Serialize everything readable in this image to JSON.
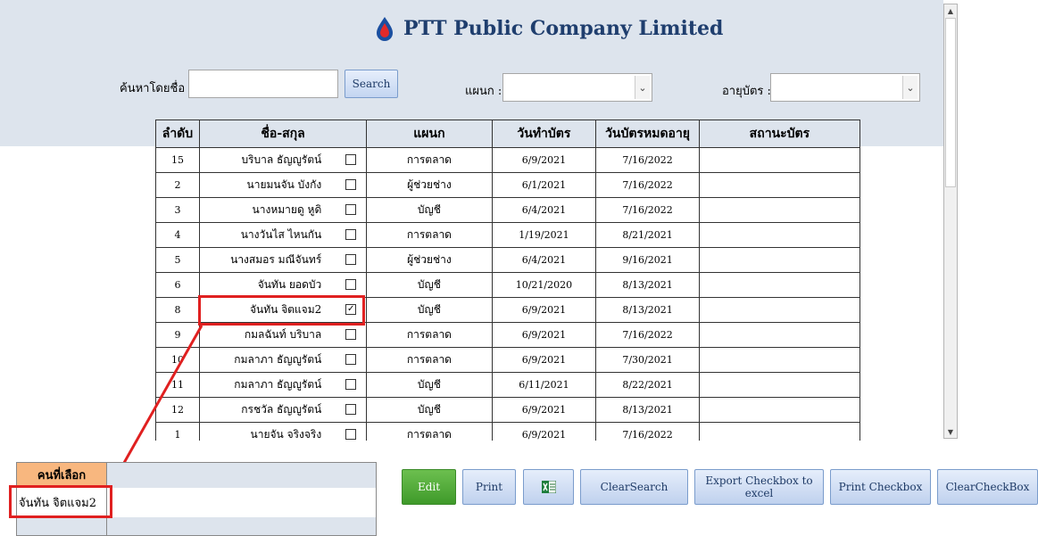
{
  "header": {
    "title": "PTT Public Company Limited"
  },
  "filters": {
    "search_label": "ค้นหาโดยชื่อ :",
    "search_value": "",
    "search_button": "Search",
    "dept_label": "แผนก :",
    "dept_value": "",
    "age_label": "อายุบัตร :",
    "age_value": ""
  },
  "table": {
    "columns": [
      "ลำดับ",
      "ชื่อ-สกุล",
      "แผนก",
      "วันทำบัตร",
      "วันบัตรหมดอายุ",
      "สถานะบัตร"
    ],
    "rows": [
      {
        "seq": "15",
        "name": "บริบาล ธัญญูรัตน์",
        "dept": "การตลาด",
        "issue": "6/9/2021",
        "expire": "7/16/2022",
        "status": "",
        "checked": false
      },
      {
        "seq": "2",
        "name": "นายมนจัน บังกัง",
        "dept": "ผู้ช่วยช่าง",
        "issue": "6/1/2021",
        "expire": "7/16/2022",
        "status": "",
        "checked": false
      },
      {
        "seq": "3",
        "name": "นางหมายดู หูดิ",
        "dept": "บัญชี",
        "issue": "6/4/2021",
        "expire": "7/16/2022",
        "status": "",
        "checked": false
      },
      {
        "seq": "4",
        "name": "นางวันไส ไหนกัน",
        "dept": "การตลาด",
        "issue": "1/19/2021",
        "expire": "8/21/2021",
        "status": "",
        "checked": false
      },
      {
        "seq": "5",
        "name": "นางสมอร มณีจันทร์",
        "dept": "ผู้ช่วยช่าง",
        "issue": "6/4/2021",
        "expire": "9/16/2021",
        "status": "",
        "checked": false
      },
      {
        "seq": "6",
        "name": "จันทัน ยอดบัว",
        "dept": "บัญชี",
        "issue": "10/21/2020",
        "expire": "8/13/2021",
        "status": "",
        "checked": false
      },
      {
        "seq": "8",
        "name": "จันทัน จิตแจม2",
        "dept": "บัญชี",
        "issue": "6/9/2021",
        "expire": "8/13/2021",
        "status": "",
        "checked": true
      },
      {
        "seq": "9",
        "name": "กมลฉันท์ บริบาล",
        "dept": "การตลาด",
        "issue": "6/9/2021",
        "expire": "7/16/2022",
        "status": "",
        "checked": false
      },
      {
        "seq": "10",
        "name": "กมลาภา ธัญญูรัตน์",
        "dept": "การตลาด",
        "issue": "6/9/2021",
        "expire": "7/30/2021",
        "status": "",
        "checked": false
      },
      {
        "seq": "11",
        "name": "กมลาภา ธัญญูรัตน์",
        "dept": "บัญชี",
        "issue": "6/11/2021",
        "expire": "8/22/2021",
        "status": "",
        "checked": false
      },
      {
        "seq": "12",
        "name": "กรชวัล ธัญญูรัตน์",
        "dept": "บัญชี",
        "issue": "6/9/2021",
        "expire": "8/13/2021",
        "status": "",
        "checked": false
      },
      {
        "seq": "1",
        "name": "นายจัน จริงจริง",
        "dept": "การตลาด",
        "issue": "6/9/2021",
        "expire": "7/16/2022",
        "status": "",
        "checked": false
      }
    ]
  },
  "selected_panel": {
    "header": "คนที่เลือก",
    "value": "จันทัน จิตแจม2"
  },
  "actions": {
    "edit": "Edit",
    "print": "Print",
    "clear_search": "ClearSearch",
    "export_checkbox": "Export Checkbox to excel",
    "print_checkbox": "Print Checkbox",
    "clear_checkbox": "ClearCheckBox"
  },
  "colors": {
    "brand_blue": "#1f3e6e",
    "highlight_red": "#e02020",
    "edit_green": "#4caf35",
    "panel_header": "#f8b77f"
  }
}
